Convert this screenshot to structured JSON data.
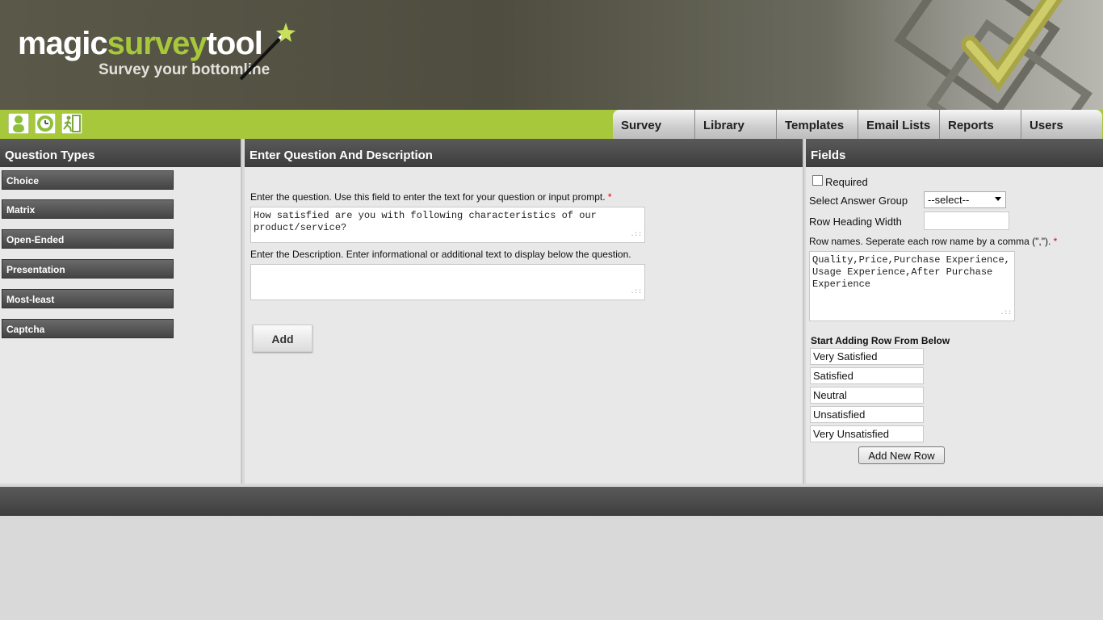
{
  "logo": {
    "word1": "magic",
    "word2": "survey",
    "word3": "tool",
    "tagline": "Survey your bottomline"
  },
  "nav": [
    "Survey",
    "Library",
    "Templates",
    "Email Lists",
    "Reports",
    "Users"
  ],
  "left": {
    "title": "Question Types",
    "types": [
      "Choice",
      "Matrix",
      "Open-Ended",
      "Presentation",
      "Most-least",
      "Captcha"
    ]
  },
  "middle": {
    "title": "Enter Question And Description",
    "question_label": "Enter the question. Use this field to enter the text for your question or input prompt.",
    "required_mark": "*",
    "question_value": "How satisfied are you with following characteristics of our product/service?",
    "description_label": "Enter the Description. Enter informational or additional text to display below the question.",
    "description_value": "",
    "add_label": "Add"
  },
  "right": {
    "title": "Fields",
    "required_label": "Required",
    "answer_group_label": "Select Answer Group",
    "answer_group_value": "--select--",
    "row_heading_width_label": "Row Heading Width",
    "row_heading_width_value": "",
    "row_names_label": "Row names. Seperate each row name by a comma (\",\").",
    "required_mark": "*",
    "row_names_value": "Quality,Price,Purchase Experience, Usage Experience,After Purchase Experience",
    "start_adding_label": "Start Adding Row From Below",
    "rows": [
      "Very Satisfied",
      "Satisfied",
      "Neutral",
      "Unsatisfied",
      "Very Unsatisfied"
    ],
    "add_new_row_label": "Add New Row"
  },
  "colors": {
    "accent_green": "#a6c83a",
    "header_dark": "#4e4d3f",
    "panel_head": "#3c3c3c"
  },
  "icons": [
    "user-icon",
    "clock-icon",
    "exit-icon",
    "magic-wand-icon",
    "checkmark-art-icon"
  ]
}
